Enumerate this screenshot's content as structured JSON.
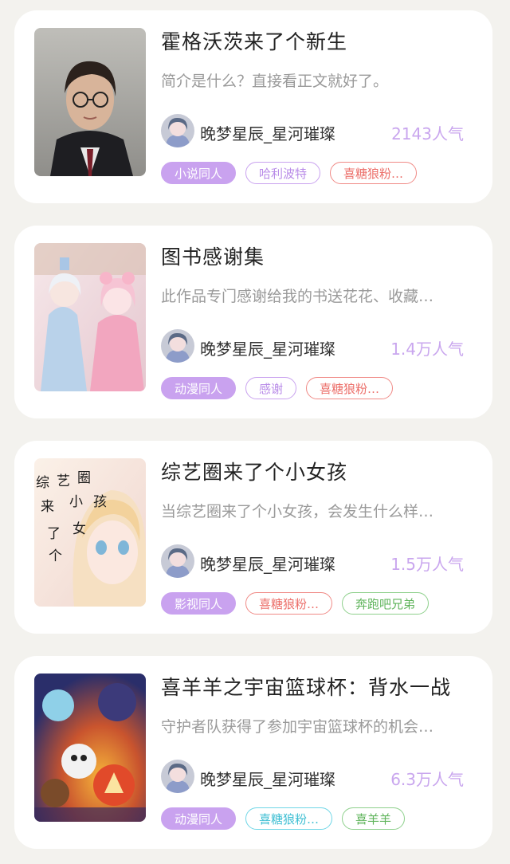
{
  "books": [
    {
      "title": "霍格沃茨来了个新生",
      "description": "简介是什么？直接看正文就好了。",
      "author": "晚梦星辰_星河璀璨",
      "popularity": "2143人气",
      "cover_icon": "harry-potter-cover-image",
      "tags": [
        {
          "label": "小说同人",
          "style": "filled"
        },
        {
          "label": "哈利波特",
          "style": "outline-purple"
        },
        {
          "label": "喜糖狼粉…",
          "style": "outline-red"
        }
      ]
    },
    {
      "title": "图书感谢集",
      "description": "此作品专门感谢给我的书送花花、收藏…",
      "author": "晚梦星辰_星河璀璨",
      "popularity": "1.4万人气",
      "cover_icon": "anime-couple-cover-image",
      "tags": [
        {
          "label": "动漫同人",
          "style": "filled"
        },
        {
          "label": "感谢",
          "style": "outline-purple"
        },
        {
          "label": "喜糖狼粉…",
          "style": "outline-red"
        }
      ]
    },
    {
      "title": "综艺圈来了个小女孩",
      "description": "当综艺圈来了个小女孩，会发生什么样…",
      "author": "晚梦星辰_星河璀璨",
      "popularity": "1.5万人气",
      "cover_icon": "anime-girl-cover-image",
      "cover_text": [
        "综",
        "艺",
        "圈",
        "来",
        "了",
        "个",
        "小",
        "女",
        "孩"
      ],
      "tags": [
        {
          "label": "影视同人",
          "style": "filled"
        },
        {
          "label": "喜糖狼粉…",
          "style": "outline-red"
        },
        {
          "label": "奔跑吧兄弟",
          "style": "outline-green"
        }
      ]
    },
    {
      "title": "喜羊羊之宇宙篮球杯：背水一战",
      "description": "守护者队获得了参加宇宙篮球杯的机会…",
      "author": "晚梦星辰_星河璀璨",
      "popularity": "6.3万人气",
      "cover_icon": "cartoon-team-cover-image",
      "tags": [
        {
          "label": "动漫同人",
          "style": "filled"
        },
        {
          "label": "喜糖狼粉…",
          "style": "outline-cyan"
        },
        {
          "label": "喜羊羊",
          "style": "outline-green"
        }
      ]
    }
  ]
}
